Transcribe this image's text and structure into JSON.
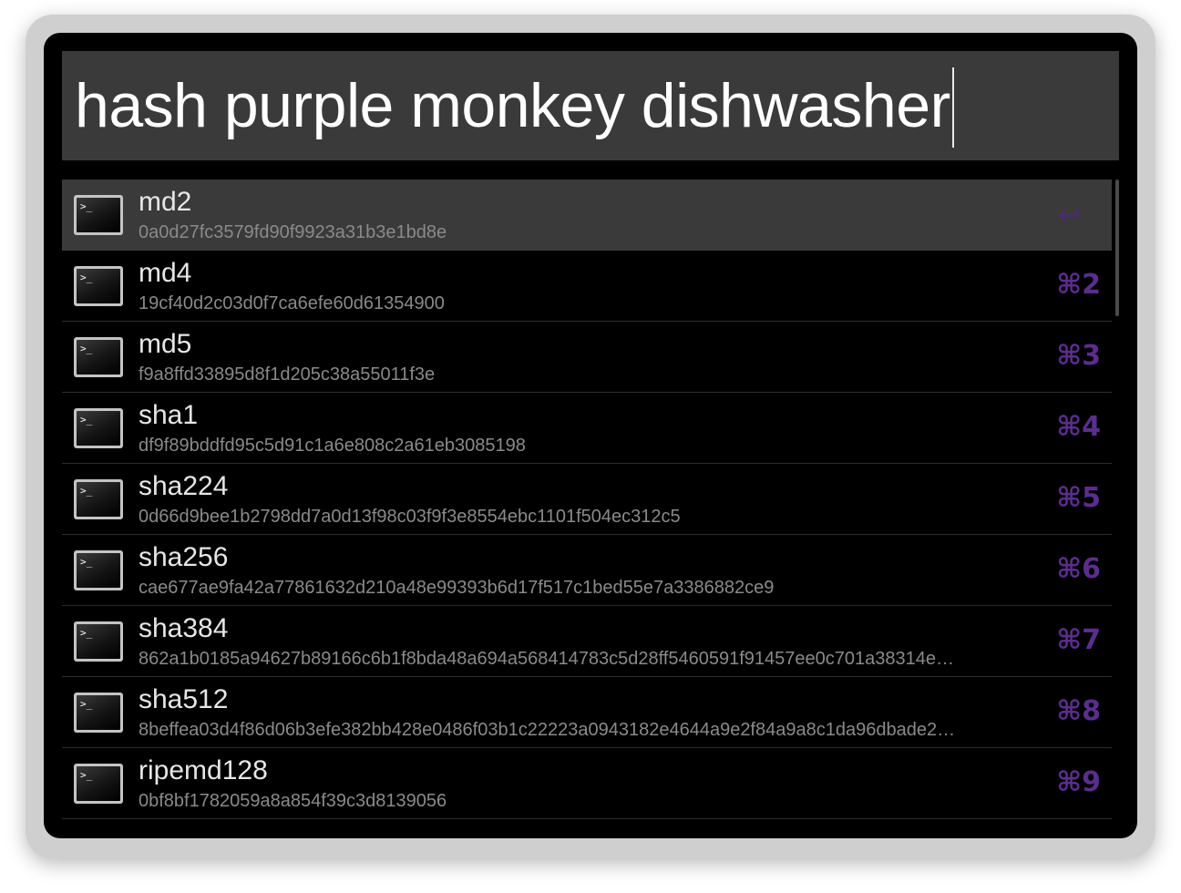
{
  "search": {
    "query": "hash purple monkey dishwasher"
  },
  "results": [
    {
      "title": "md2",
      "subtitle": "0a0d27fc3579fd90f9923a31b3e1bd8e",
      "shortcut": "↩",
      "selected": true,
      "icon": "terminal-icon"
    },
    {
      "title": "md4",
      "subtitle": "19cf40d2c03d0f7ca6efe60d61354900",
      "shortcut": "⌘2",
      "icon": "terminal-icon"
    },
    {
      "title": "md5",
      "subtitle": "f9a8ffd33895d8f1d205c38a55011f3e",
      "shortcut": "⌘3",
      "icon": "terminal-icon"
    },
    {
      "title": "sha1",
      "subtitle": "df9f89bddfd95c5d91c1a6e808c2a61eb3085198",
      "shortcut": "⌘4",
      "icon": "terminal-icon"
    },
    {
      "title": "sha224",
      "subtitle": "0d66d9bee1b2798dd7a0d13f98c03f9f3e8554ebc1101f504ec312c5",
      "shortcut": "⌘5",
      "icon": "terminal-icon"
    },
    {
      "title": "sha256",
      "subtitle": "cae677ae9fa42a77861632d210a48e99393b6d17f517c1bed55e7a3386882ce9",
      "shortcut": "⌘6",
      "icon": "terminal-icon"
    },
    {
      "title": "sha384",
      "subtitle": "862a1b0185a94627b89166c6b1f8bda48a694a568414783c5d28ff5460591f91457ee0c701a38314e…",
      "shortcut": "⌘7",
      "icon": "terminal-icon"
    },
    {
      "title": "sha512",
      "subtitle": "8beffea03d4f86d06b3efe382bb428e0486f03b1c22223a0943182e4644a9e2f84a9a8c1da96dbade2…",
      "shortcut": "⌘8",
      "icon": "terminal-icon"
    },
    {
      "title": "ripemd128",
      "subtitle": "0bf8bf1782059a8a854f39c3d8139056",
      "shortcut": "⌘9",
      "icon": "terminal-icon"
    }
  ],
  "colors": {
    "accent": "#5b2d8e",
    "selected_row": "#3a3a3a",
    "panel": "#000000"
  }
}
